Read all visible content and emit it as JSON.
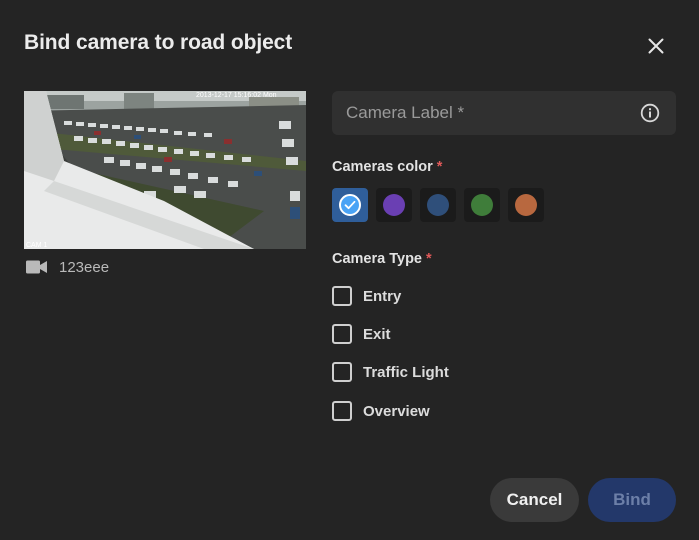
{
  "dialog": {
    "title": "Bind camera to road object"
  },
  "camera_preview": {
    "timestamp": "2013-12-17 15:16:02 Mon",
    "overlay_label": "CAM 1",
    "camera_name": "123eee"
  },
  "label_field": {
    "placeholder": "Camera Label *",
    "value": ""
  },
  "colors_section": {
    "label": "Cameras color",
    "required_mark": "*",
    "swatches": [
      "#4aa3f5",
      "#6a3fb3",
      "#2f4f7a",
      "#3f7d3a",
      "#b8683f"
    ],
    "selected_index": 0
  },
  "type_section": {
    "label": "Camera Type",
    "required_mark": "*",
    "options": [
      {
        "label": "Entry",
        "checked": false
      },
      {
        "label": "Exit",
        "checked": false
      },
      {
        "label": "Traffic Light",
        "checked": false
      },
      {
        "label": "Overview",
        "checked": false
      }
    ]
  },
  "actions": {
    "cancel_label": "Cancel",
    "bind_label": "Bind"
  }
}
